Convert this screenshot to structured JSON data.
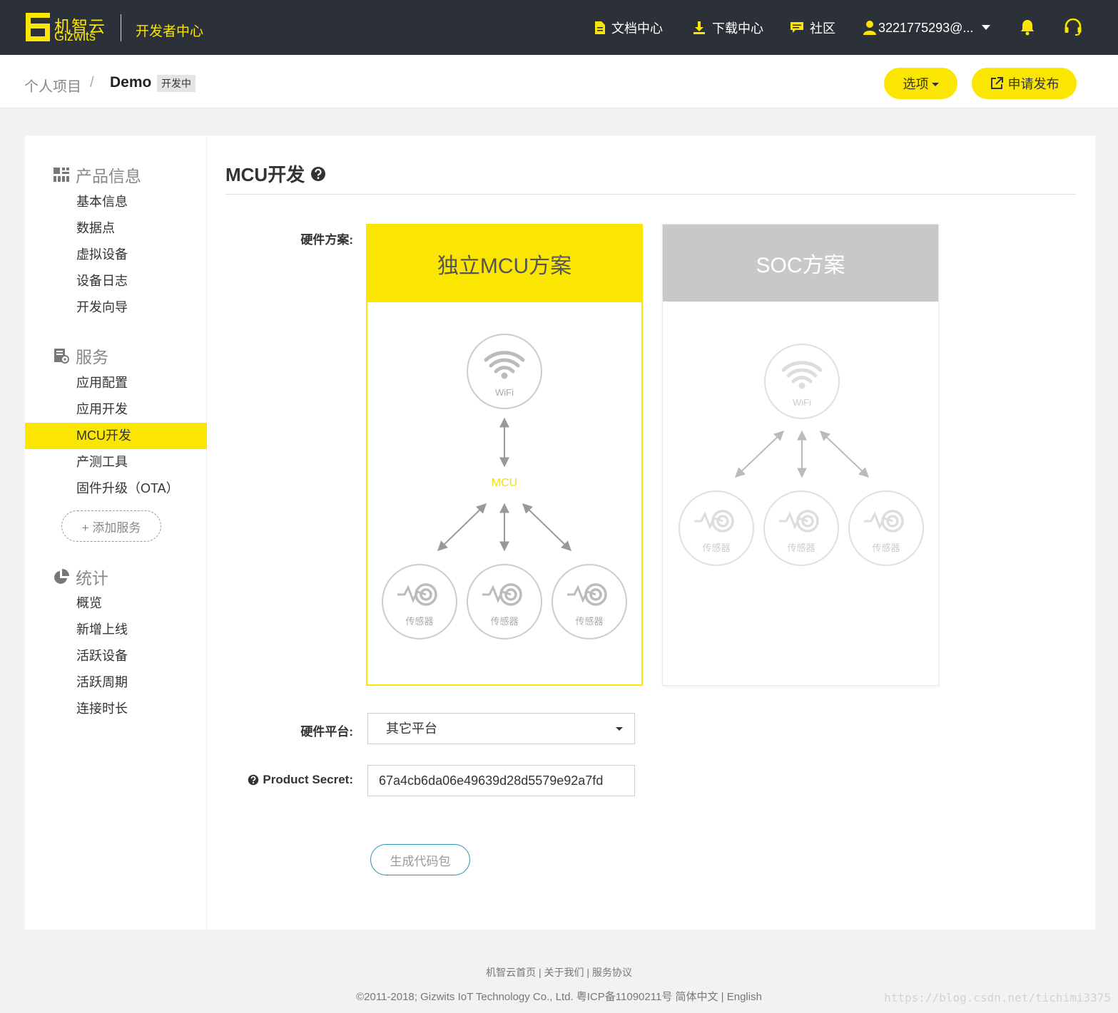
{
  "topbar": {
    "logo_cn": "机智云",
    "logo_en": "Gizwits",
    "dev_center": "开发者中心",
    "docs": "文档中心",
    "downloads": "下载中心",
    "community": "社区",
    "account": "3221775293@..."
  },
  "breadcrumb": {
    "root": "个人项目",
    "separator": "/",
    "current": "Demo",
    "badge": "开发中"
  },
  "actions": {
    "options": "选项",
    "publish": "申请发布"
  },
  "sidebar": {
    "groups": [
      {
        "label": "产品信息",
        "icon": "grid-icon",
        "items": [
          "基本信息",
          "数据点",
          "虚拟设备",
          "设备日志",
          "开发向导"
        ]
      },
      {
        "label": "服务",
        "icon": "service-icon",
        "items": [
          "应用配置",
          "应用开发",
          "MCU开发",
          "产测工具",
          "固件升级（OTA）"
        ]
      },
      {
        "label": "统计",
        "icon": "pie-chart-icon",
        "items": [
          "概览",
          "新增上线",
          "活跃设备",
          "活跃周期",
          "连接时长"
        ]
      }
    ],
    "active_item": "MCU开发",
    "add_service": "+ 添加服务"
  },
  "main": {
    "title": "MCU开发",
    "hardware_scheme_label": "硬件方案:",
    "cards": [
      {
        "title": "独立MCU方案",
        "selected": true,
        "wifi": "WiFi",
        "mcu": "MCU",
        "sensor": "传感器"
      },
      {
        "title": "SOC方案",
        "selected": false,
        "wifi": "WiFi",
        "sensor": "传感器"
      }
    ],
    "hardware_platform_label": "硬件平台:",
    "hardware_platform_value": "其它平台",
    "product_secret_label": "Product Secret:",
    "product_secret_value": "67a4cb6da06e49639d28d5579e92a7fd",
    "generate_button": "生成代码包"
  },
  "footer": {
    "links": "机智云首页 | 关于我们 | 服务协议",
    "copyright": "©2011-2018; Gizwits IoT Technology Co., Ltd. 粤ICP备11090211号 简体中文 | English"
  },
  "watermark": "https://blog.csdn.net/tichimi3375",
  "colors": {
    "accent": "#fae600",
    "topbar": "#2c3038",
    "teal": "#2a93b0"
  }
}
